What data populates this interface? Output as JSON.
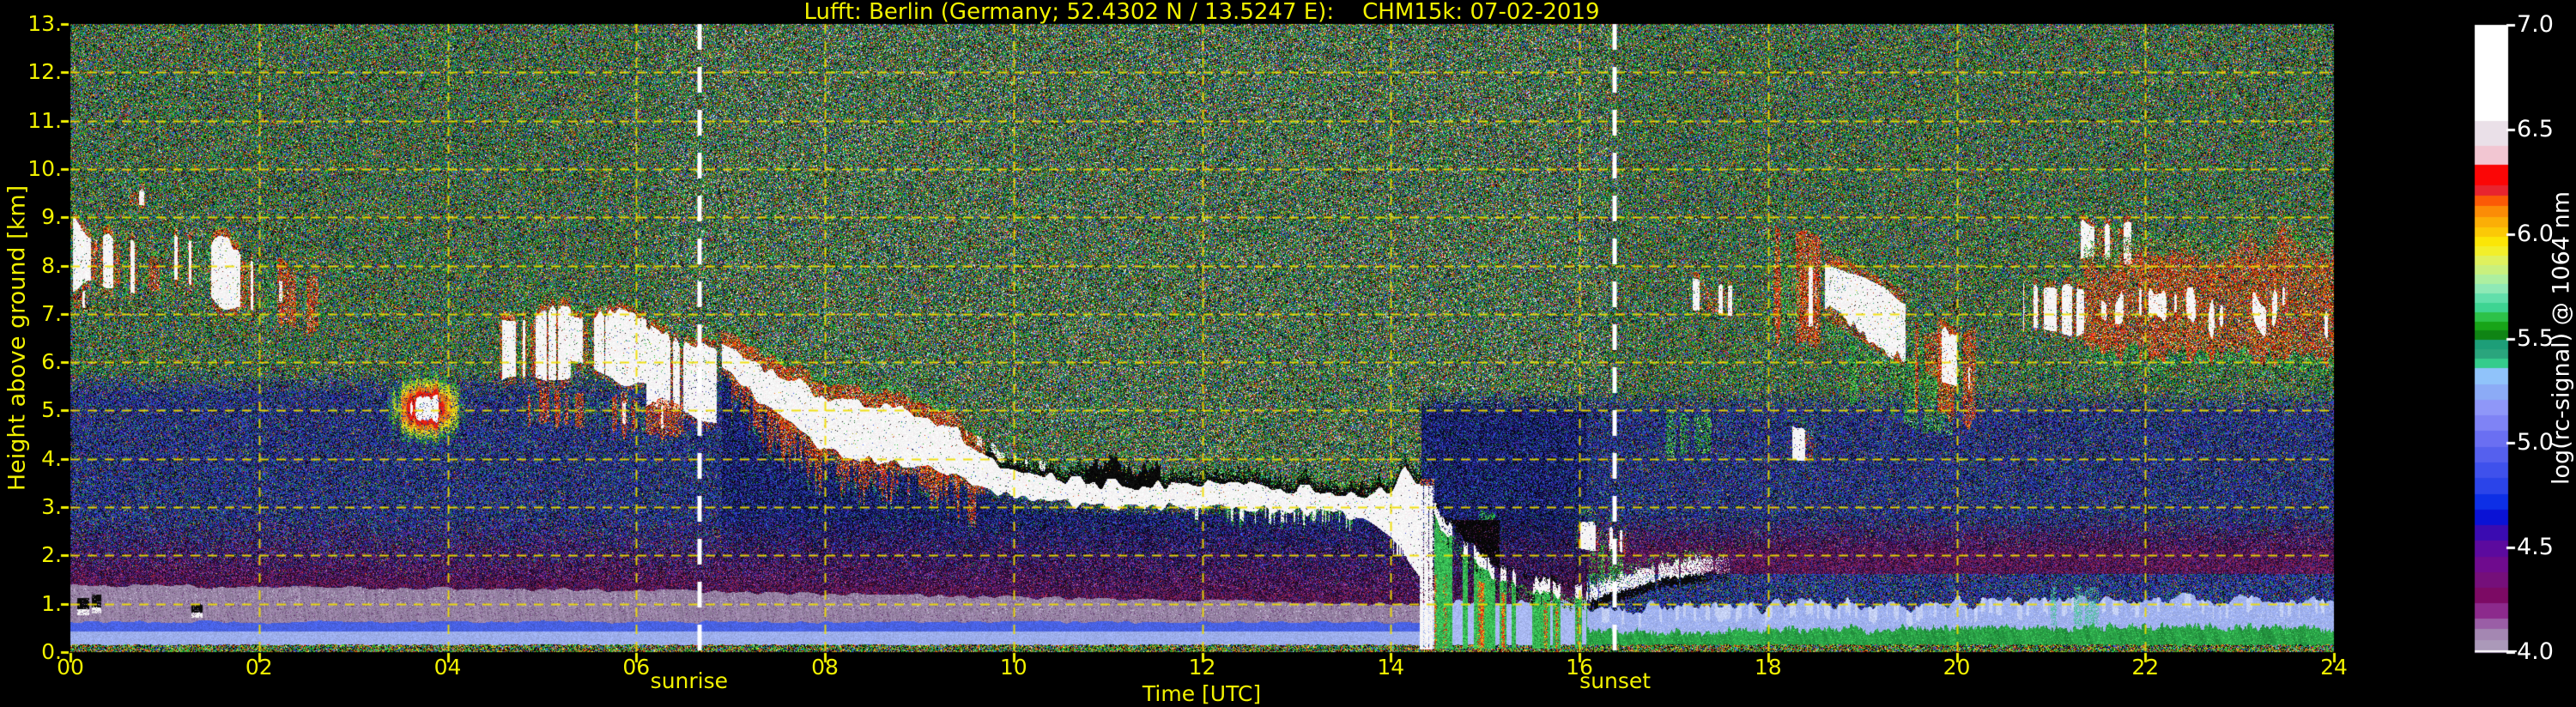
{
  "app": {
    "background": "#000000"
  },
  "chart_data": {
    "type": "heatmap",
    "title": "Lufft: Berlin (Germany; 52.4302 N / 13.5247 E):    CHM15k: 07-02-2019",
    "xlabel": "Time [UTC]",
    "ylabel": "Height above ground [km]",
    "x_range_hours": [
      0,
      24
    ],
    "y_range_km": [
      0,
      13
    ],
    "x_tick_labels": [
      "00",
      "02",
      "04",
      "06",
      "08",
      "10",
      "12",
      "14",
      "16",
      "18",
      "20",
      "22",
      "24"
    ],
    "y_tick_labels": [
      "0.",
      "1.",
      "2.",
      "3.",
      "4.",
      "5.",
      "6.",
      "7.",
      "8.",
      "9.",
      "10.",
      "11.",
      "12.",
      "13."
    ],
    "grid_color": "#f0de00",
    "axis_text_color": "#f2f200",
    "sun_lines": [
      {
        "name": "sunrise",
        "label": "sunrise",
        "hour": 6.67
      },
      {
        "name": "sunset",
        "label": "sunset",
        "hour": 16.37
      }
    ],
    "colorbar": {
      "label": "log(rc-signal) @ 1064 nm",
      "tick_labels": [
        "7.0",
        "6.5",
        "6.0",
        "5.5",
        "5.0",
        "4.5",
        "4.0"
      ],
      "tick_values": [
        7.0,
        6.5,
        6.0,
        5.5,
        5.0,
        4.5,
        4.0
      ],
      "range": [
        4.0,
        7.0
      ],
      "bands": [
        [
          7.0,
          "#ffffff"
        ],
        [
          6.54,
          "#eae0e8"
        ],
        [
          6.42,
          "#f2c6d2"
        ],
        [
          6.33,
          "#fb0606"
        ],
        [
          6.23,
          "#e8242e"
        ],
        [
          6.18,
          "#fb5a06"
        ],
        [
          6.13,
          "#fb8c06"
        ],
        [
          6.08,
          "#fbae06"
        ],
        [
          6.03,
          "#fbc906"
        ],
        [
          5.985,
          "#fbe606"
        ],
        [
          5.94,
          "#f2ef2a"
        ],
        [
          5.895,
          "#dff15e"
        ],
        [
          5.85,
          "#c9f07e"
        ],
        [
          5.805,
          "#adefa0"
        ],
        [
          5.76,
          "#8fe9b6"
        ],
        [
          5.715,
          "#62dfab"
        ],
        [
          5.67,
          "#3ed492"
        ],
        [
          5.625,
          "#2dc249"
        ],
        [
          5.58,
          "#18a418"
        ],
        [
          5.535,
          "#0f8414"
        ],
        [
          5.49,
          "#1d9e78"
        ],
        [
          5.445,
          "#2aa57d"
        ],
        [
          5.4,
          "#35cc8c"
        ],
        [
          5.355,
          "#90c3fa"
        ],
        [
          5.28,
          "#8cabf6"
        ],
        [
          5.205,
          "#8f97f8"
        ],
        [
          5.13,
          "#7f83f5"
        ],
        [
          5.055,
          "#6a6ff2"
        ],
        [
          4.98,
          "#5560ee"
        ],
        [
          4.905,
          "#3f51ec"
        ],
        [
          4.83,
          "#2b44e9"
        ],
        [
          4.755,
          "#0d2fe6"
        ],
        [
          4.68,
          "#0a12d5"
        ],
        [
          4.605,
          "#3a0bb1"
        ],
        [
          4.53,
          "#5c0a9e"
        ],
        [
          4.455,
          "#6f0b8e"
        ],
        [
          4.38,
          "#750f7a"
        ],
        [
          4.305,
          "#7c0a64"
        ],
        [
          4.23,
          "#8c2a8c"
        ],
        [
          4.16,
          "#9a5ea6"
        ],
        [
          4.11,
          "#a487b2"
        ],
        [
          4.055,
          "#ab99b9"
        ]
      ]
    },
    "boundary_layer": {
      "mauve_top_t": [
        0,
        6,
        10,
        14.3
      ],
      "mauve_top_h": [
        1.35,
        1.25,
        1.1,
        0.95
      ],
      "mauve_bot": 0.6,
      "blue_line": [
        0.44,
        0.6
      ],
      "ground_top": 0.15,
      "purple_fade_top": 2.85,
      "evening_peri_t": [
        16.1,
        18,
        20,
        22,
        24
      ],
      "evening_peri_h": [
        0.9,
        0.95,
        1.0,
        1.08,
        1.15
      ],
      "evening_blue_top": 1.62,
      "evening_purplered_top": 2.12,
      "night_blue_top": 5.6,
      "evening_noise_blue_top": 5.2,
      "teal_wisp": [
        20.85,
        21.55
      ]
    },
    "main_cloud_band": {
      "t_pts": [
        6.9,
        7.3,
        7.8,
        8.0,
        8.6,
        9.0,
        9.4,
        9.8,
        10.2,
        10.8,
        11.4,
        12.0,
        12.6,
        13.2,
        13.7,
        14.0,
        14.15,
        14.32
      ],
      "top_pts": [
        6.35,
        5.9,
        5.5,
        5.3,
        5.1,
        4.9,
        4.55,
        3.95,
        3.7,
        3.5,
        3.45,
        3.5,
        3.4,
        3.35,
        3.25,
        3.35,
        3.85,
        3.5
      ],
      "bot_pts": [
        5.9,
        5.2,
        4.5,
        4.15,
        3.95,
        3.85,
        3.6,
        3.35,
        3.15,
        3.05,
        3.0,
        3.05,
        3.0,
        2.9,
        2.8,
        2.45,
        2.0,
        1.6
      ],
      "red_fringe_until": 9.7,
      "virga": [
        7.0,
        9.6
      ],
      "black_marker_from": 9.7,
      "big_marker": [
        10.75,
        11.55
      ],
      "teeth": [
        11.9,
        13.6
      ],
      "scatter_white": [
        9.5,
        10.4
      ],
      "white_spike": [
        14.02,
        14.18
      ]
    },
    "precipitation": {
      "t0": 14.3,
      "t1": 16.08,
      "cap_t": [
        14.3,
        14.5,
        14.75,
        15.1,
        15.5,
        16.08
      ],
      "cap_h": [
        3.4,
        2.65,
        2.1,
        1.5,
        1.25,
        1.05
      ],
      "initial_column": [
        14.3,
        14.46
      ],
      "attenuation": [
        14.55,
        15.15
      ]
    },
    "marker_line": {
      "t0": 16.08,
      "t1": 17.65,
      "t_pts": [
        16.08,
        16.5,
        16.9,
        17.3,
        17.65
      ],
      "h_pts": [
        0.95,
        1.18,
        1.4,
        1.5,
        1.55
      ]
    },
    "clouds": [
      {
        "kind": "streak",
        "t0": 0.02,
        "t1": 0.52,
        "top": [
          8.85,
          8.45
        ],
        "bot": [
          7.55,
          7.65
        ],
        "w": 0.7,
        "red": 0.55,
        "seed": 1
      },
      {
        "kind": "streak",
        "t0": 0.0,
        "t1": 0.15,
        "top": [
          7.6,
          7.5
        ],
        "bot": [
          7.0,
          7.1
        ],
        "w": 0.7,
        "red": 0.35,
        "seed": 2
      },
      {
        "kind": "streak",
        "t0": 0.55,
        "t1": 1.0,
        "top": [
          8.6,
          8.25
        ],
        "bot": [
          7.45,
          7.3
        ],
        "w": 0.55,
        "red": 0.5,
        "seed": 3
      },
      {
        "kind": "streak",
        "t0": 0.6,
        "t1": 0.8,
        "top": [
          9.6,
          9.55
        ],
        "bot": [
          9.25,
          9.2
        ],
        "w": 0.4,
        "red": 0.3,
        "seed": 4
      },
      {
        "kind": "streak",
        "t0": 1.1,
        "t1": 1.95,
        "top": [
          8.75,
          8.15
        ],
        "bot": [
          7.6,
          7.0
        ],
        "w": 0.6,
        "red": 0.6,
        "seed": 5
      },
      {
        "kind": "redstreak",
        "t0": 2.05,
        "t1": 2.7,
        "top": [
          8.1,
          7.55
        ],
        "bot": [
          6.95,
          6.55
        ],
        "seed": 6
      },
      {
        "kind": "rainbow",
        "t0": 3.35,
        "t1": 4.18,
        "hc": 5.05,
        "hw": 0.75,
        "seed": 7
      },
      {
        "kind": "streak",
        "t0": 4.55,
        "t1": 5.3,
        "top": [
          6.95,
          7.0
        ],
        "bot": [
          5.55,
          5.8
        ],
        "w": 0.75,
        "red": 0.6,
        "seed": 8
      },
      {
        "kind": "streak",
        "t0": 5.3,
        "t1": 6.1,
        "top": [
          7.1,
          6.9
        ],
        "bot": [
          5.9,
          5.55
        ],
        "w": 0.95,
        "red": 0.35,
        "seed": 9
      },
      {
        "kind": "streak",
        "t0": 6.1,
        "t1": 6.85,
        "top": [
          6.6,
          6.05
        ],
        "bot": [
          5.25,
          4.85
        ],
        "w": 0.85,
        "red": 0.5,
        "seed": 10
      },
      {
        "kind": "redstreak",
        "t0": 4.8,
        "t1": 6.5,
        "top": [
          5.55,
          4.95
        ],
        "bot": [
          4.85,
          4.45
        ],
        "seed": 11
      },
      {
        "kind": "streak",
        "t0": 15.95,
        "t1": 16.5,
        "top": [
          2.75,
          2.5
        ],
        "bot": [
          2.1,
          2.05
        ],
        "w": 0.5,
        "red": 0.15,
        "seed": 12
      },
      {
        "kind": "greenvirga",
        "t0": 16.1,
        "t1": 16.5,
        "top": [
          2.15,
          1.95
        ],
        "bot": [
          1.3,
          1.35
        ],
        "seed": 13
      },
      {
        "kind": "greenvirga",
        "t0": 16.9,
        "t1": 17.4,
        "top": [
          5.0,
          4.8
        ],
        "bot": [
          4.05,
          4.0
        ],
        "seed": 14
      },
      {
        "kind": "streak",
        "t0": 17.2,
        "t1": 17.62,
        "top": [
          7.85,
          7.6
        ],
        "bot": [
          6.95,
          6.9
        ],
        "w": 0.6,
        "red": 0.2,
        "seed": 15
      },
      {
        "kind": "redstreak",
        "t0": 18.0,
        "t1": 18.55,
        "top": [
          8.9,
          8.55
        ],
        "bot": [
          6.5,
          6.45
        ],
        "seed": 16
      },
      {
        "kind": "streak",
        "t0": 18.05,
        "t1": 18.5,
        "top": [
          8.2,
          8.0
        ],
        "bot": [
          6.65,
          6.7
        ],
        "w": 0.55,
        "red": 0.5,
        "seed": 17
      },
      {
        "kind": "streak",
        "t0": 18.25,
        "t1": 18.48,
        "top": [
          4.7,
          4.6
        ],
        "bot": [
          3.95,
          3.9
        ],
        "w": 0.6,
        "red": 0.1,
        "seed": 18
      },
      {
        "kind": "cloudmass",
        "t0": 18.6,
        "t1": 19.45,
        "top": [
          8.35,
          7.5
        ],
        "bot": [
          6.9,
          5.9
        ],
        "wtop": [
          7.95,
          7.25
        ],
        "wbot": [
          7.15,
          6.0
        ],
        "seed": 19
      },
      {
        "kind": "greenvirga",
        "t0": 18.85,
        "t1": 19.95,
        "top": [
          6.3,
          5.85
        ],
        "bot": [
          5.25,
          4.35
        ],
        "seed": 20
      },
      {
        "kind": "redstreak",
        "t0": 19.5,
        "t1": 20.2,
        "top": [
          7.0,
          6.55
        ],
        "bot": [
          5.15,
          4.75
        ],
        "seed": 21
      },
      {
        "kind": "streak",
        "t0": 19.6,
        "t1": 20.0,
        "top": [
          6.75,
          6.45
        ],
        "bot": [
          5.8,
          5.6
        ],
        "w": 0.65,
        "red": 0.5,
        "seed": 22
      },
      {
        "kind": "streak",
        "t0": 20.7,
        "t1": 21.35,
        "top": [
          7.6,
          7.45
        ],
        "bot": [
          6.7,
          6.6
        ],
        "w": 0.55,
        "red": 0.45,
        "seed": 23
      },
      {
        "kind": "streak",
        "t0": 21.3,
        "t1": 21.85,
        "top": [
          8.85,
          8.7
        ],
        "bot": [
          8.2,
          8.15
        ],
        "w": 0.45,
        "red": 0.35,
        "seed": 24
      },
      {
        "kind": "bigmass",
        "t0": 21.35,
        "t1": 24.01,
        "top": [
          7.9,
          8.45
        ],
        "bot": [
          6.3,
          6.0
        ],
        "seed": 25
      },
      {
        "kind": "cloudlet",
        "t0": 0.07,
        "t1": 0.2,
        "h0": 0.78,
        "h1": 1.12,
        "seed": 26
      },
      {
        "kind": "cloudlet",
        "t0": 0.22,
        "t1": 0.32,
        "h0": 0.8,
        "h1": 1.2,
        "seed": 27
      },
      {
        "kind": "cloudlet",
        "t0": 1.28,
        "t1": 1.4,
        "h0": 0.72,
        "h1": 1.0,
        "seed": 28
      },
      {
        "kind": "greenvirga",
        "t0": 14.9,
        "t1": 15.1,
        "top": [
          2.9,
          2.8
        ],
        "bot": [
          2.2,
          2.2
        ],
        "seed": 29
      }
    ],
    "palettes": {
      "high": [
        [
          "#22a832",
          0.3
        ],
        [
          "#2e4fd8",
          0.15
        ],
        [
          "#17906a",
          0.07
        ],
        [
          "#cc2a14",
          0.08
        ],
        [
          "#e0661a",
          0.07
        ],
        [
          "#cfc31e",
          0.08
        ],
        [
          "#e0e0e0",
          0.035
        ],
        [
          "#a03ca0",
          0.045
        ],
        [
          "#28a0c0",
          0.035
        ],
        [
          "#0d5518",
          0.07
        ],
        [
          "#060606",
          0.155
        ]
      ],
      "blue": [
        [
          "#2a3cc8",
          0.27
        ],
        [
          "#4358e0",
          0.12
        ],
        [
          "#1a1a70",
          0.16
        ],
        [
          "#22a040",
          0.09
        ],
        [
          "#6a22a0",
          0.06
        ],
        [
          "#cc3018",
          0.035
        ],
        [
          "#c8b820",
          0.03
        ],
        [
          "#157a8a",
          0.05
        ],
        [
          "#050510",
          0.185
        ]
      ],
      "navy": [
        [
          "#2434b8",
          0.3
        ],
        [
          "#3c56e0",
          0.12
        ],
        [
          "#12124e",
          0.24
        ],
        [
          "#18a038",
          0.05
        ],
        [
          "#6a1a8a",
          0.05
        ],
        [
          "#05050e",
          0.24
        ]
      ],
      "purple": [
        [
          "#7a1f7a",
          0.24
        ],
        [
          "#50105c",
          0.2
        ],
        [
          "#b35a9e",
          0.1
        ],
        [
          "#30309e",
          0.1
        ],
        [
          "#c02020",
          0.04
        ],
        [
          "#200a28",
          0.32
        ]
      ],
      "purplered": [
        [
          "#8a2050",
          0.2
        ],
        [
          "#7a1f7a",
          0.2
        ],
        [
          "#b03060",
          0.08
        ],
        [
          "#3030a0",
          0.14
        ],
        [
          "#2a0a30",
          0.38
        ]
      ],
      "ground": [
        [
          "#20c040",
          0.28
        ],
        [
          "#d0d020",
          0.12
        ],
        [
          "#d03010",
          0.12
        ],
        [
          "#3050e0",
          0.12
        ],
        [
          "#e08020",
          0.08
        ],
        [
          "#c0c0c0",
          0.04
        ],
        [
          "#050505",
          0.24
        ]
      ],
      "dark": [
        [
          "#050505",
          0.8
        ],
        [
          "#3a2060",
          0.08
        ],
        [
          "#2828a0",
          0.07
        ],
        [
          "#803080",
          0.05
        ]
      ],
      "redf": [
        [
          "#e82210",
          0.4
        ],
        [
          "#f06a10",
          0.22
        ],
        [
          "#f0f0f0",
          0.1
        ],
        [
          "#e8c020",
          0.1
        ],
        [
          "#141414",
          0.18
        ]
      ],
      "greenf": [
        [
          "#28b840",
          0.45
        ],
        [
          "#9cd830",
          0.15
        ],
        [
          "#18a070",
          0.12
        ],
        [
          "#f0f0f0",
          0.06
        ],
        [
          "#0a0a0a",
          0.22
        ]
      ],
      "redcore": [
        [
          "#e02010",
          0.5
        ],
        [
          "#f08018",
          0.3
        ],
        [
          "#f0d020",
          0.2
        ]
      ],
      "mauve_colors": [
        "#a792b4",
        "#8f7a9e",
        "#6b3a78",
        "#cfd0e0"
      ],
      "peri": "#9fb1f0",
      "peri_light": "#c6d2f8",
      "peri_rain": "#a8b8f2",
      "blue_line": "#4a63e6",
      "green_layer": [
        "#2fae4e",
        "#1f8a3a",
        "#46d060"
      ],
      "teal": "#54c4a4"
    }
  }
}
